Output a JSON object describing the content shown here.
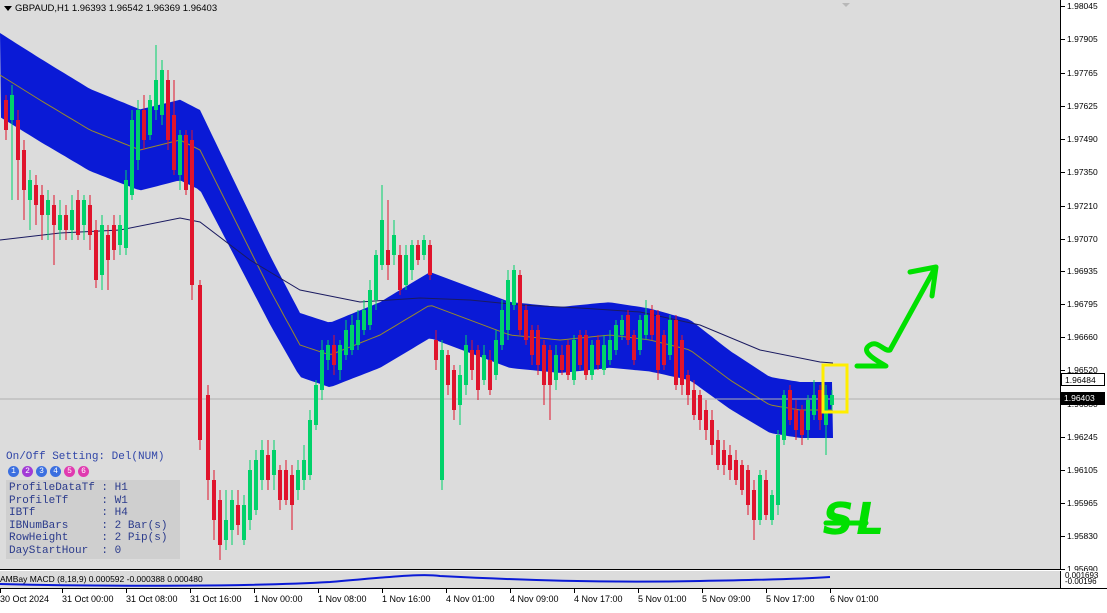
{
  "header": {
    "symbol_line": "GBPAUD,H1  1.96393 1.96542 1.96369 1.96403"
  },
  "price_axis": {
    "ticks": [
      "1.98045",
      "1.97905",
      "1.97765",
      "1.97625",
      "1.97490",
      "1.97350",
      "1.97210",
      "1.97070",
      "1.96935",
      "1.96795",
      "1.96660",
      "1.96520",
      "1.96380",
      "1.96245",
      "1.96105",
      "1.95965",
      "1.95830",
      "1.95690"
    ],
    "ask_label": "1.96484",
    "bid_label": "1.96403"
  },
  "profile_panel": {
    "title": "On/Off Setting: Del(NUM)",
    "dots": [
      {
        "label": "1",
        "color": "#3b6fe0"
      },
      {
        "label": "2",
        "color": "#a23bd6"
      },
      {
        "label": "3",
        "color": "#3b6fe0"
      },
      {
        "label": "4",
        "color": "#3b6fe0"
      },
      {
        "label": "5",
        "color": "#e03bb0"
      },
      {
        "label": "6",
        "color": "#e03bb0"
      }
    ],
    "rows": [
      "ProfileDataTf : H1",
      "ProfileTf     : W1",
      "IBTf          : H4",
      "IBNumBars     : 2 Bar(s)",
      "RowHeight     : 2 Pip(s)",
      "DayStartHour  : 0"
    ]
  },
  "macd": {
    "label": "AMBay  MACD (8,18,9) 0.000592 -0.000388 0.000480",
    "axis_top": "0.001693",
    "axis_bottom": "-0.00196"
  },
  "time_axis": {
    "labels": [
      "30 Oct 2024",
      "31 Oct 00:00",
      "31 Oct 08:00",
      "31 Oct 16:00",
      "1 Nov 00:00",
      "1 Nov 08:00",
      "1 Nov 16:00",
      "4 Nov 01:00",
      "4 Nov 09:00",
      "4 Nov 17:00",
      "5 Nov 01:00",
      "5 Nov 09:00",
      "5 Nov 17:00",
      "6 Nov 01:00"
    ]
  },
  "annotations": {
    "sl_text": "SL"
  },
  "colors": {
    "background": "#dcdcdc",
    "bull_candle": "#00d26a",
    "bear_candle": "#e0142c",
    "band_fill": "#0a1ad6",
    "annotation_green": "#00e000",
    "highlight_box": "#ffee00"
  }
}
